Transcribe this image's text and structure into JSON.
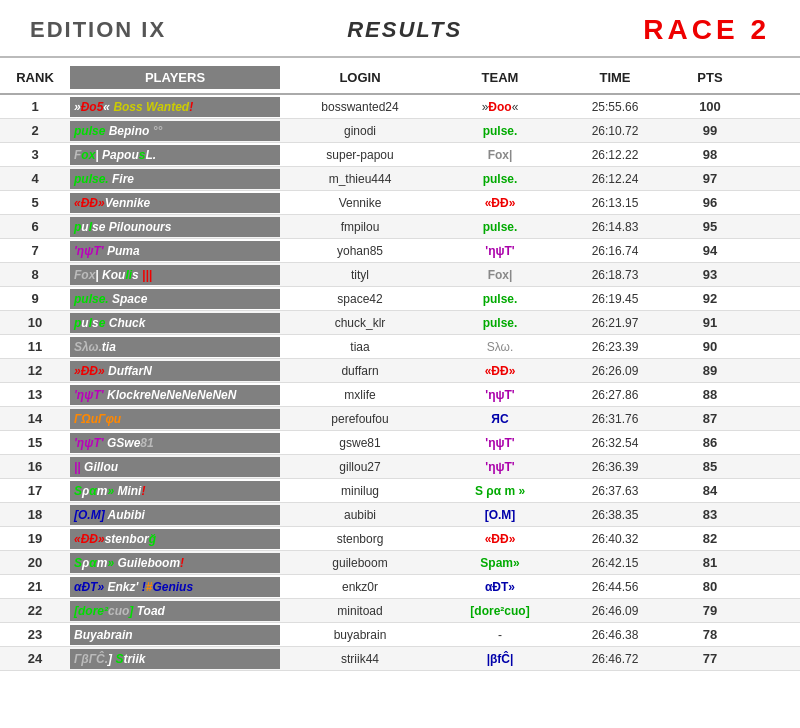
{
  "header": {
    "edition": "EDITION IX",
    "results": "RESULTS",
    "race": "RACE  2"
  },
  "columns": {
    "rank": "RANK",
    "players": "PLAYERS",
    "login": "LOGIN",
    "team": "TEAM",
    "time": "TIME",
    "pts": "PTS"
  },
  "rows": [
    {
      "rank": "1",
      "player_html": "»<span class='p-red'>Ðo5</span>« <span class='p-yellow'>Boss Wanted</span><span class='p-red'>!</span>",
      "login": "bosswanted24",
      "team_html": "»<span class='team-dd'>Ðoo</span>«",
      "time": "25:55.66",
      "pts": "100"
    },
    {
      "rank": "2",
      "player_html": "<span class='p-green'>pulse</span> <span class='p-white'>Bepino</span> <span class='p-gray'>°°</span>",
      "login": "ginodi",
      "team_html": "<span class='team-pulse'>pulse.</span>",
      "time": "26:10.72",
      "pts": "99"
    },
    {
      "rank": "3",
      "player_html": "<span class='p-gray'>F</span><span class='p-green'>ox</span><span class='p-white'>|</span> <span class='p-white'>Papou</span><span class='p-green'>s</span><span class='p-white'>L.</span>",
      "login": "super-papou",
      "team_html": "<span class='team-fox'>Fox|</span>",
      "time": "26:12.22",
      "pts": "98"
    },
    {
      "rank": "4",
      "player_html": "<span class='p-green'>pulse.</span> <span class='p-white'>Fire</span>",
      "login": "m_thieu444",
      "team_html": "<span class='team-pulse'>pulse.</span>",
      "time": "26:12.24",
      "pts": "97"
    },
    {
      "rank": "5",
      "player_html": "<span class='p-red'>«ÐÐ»</span><span class='p-white'>Vennike</span>",
      "login": "Vennike",
      "team_html": "<span class='team-dd'>«ÐÐ»</span>",
      "time": "26:13.15",
      "pts": "96"
    },
    {
      "rank": "6",
      "player_html": "<span class='p-green'>p</span><span class='p-white'>u</span><span class='p-green'>l</span><span class='p-white'>se</span> <span class='p-white'>Pilounours</span>",
      "login": "fmpilou",
      "team_html": "<span class='team-pulse'>pulse.</span>",
      "time": "26:14.83",
      "pts": "95"
    },
    {
      "rank": "7",
      "player_html": "<span class='p-purple'>'ηψΤ'</span> <span class='p-white'>Puma</span>",
      "login": "yohan85",
      "team_html": "<span class='team-hut'>'ηψΤ'</span>",
      "time": "26:16.74",
      "pts": "94"
    },
    {
      "rank": "8",
      "player_html": "<span class='p-gray'>Fox</span><span class='p-white'>| </span><span class='p-white'>Kou</span><span class='p-green'>li</span><span class='p-white'>s</span> <span class='p-red'>|||</span>",
      "login": "tityl",
      "team_html": "<span class='team-fox'>Fox|</span>",
      "time": "26:18.73",
      "pts": "93"
    },
    {
      "rank": "9",
      "player_html": "<span class='p-green'>pulse.</span> <span class='p-white'>Space</span>",
      "login": "space42",
      "team_html": "<span class='team-pulse'>pulse.</span>",
      "time": "26:19.45",
      "pts": "92"
    },
    {
      "rank": "10",
      "player_html": "<span class='p-green'>p</span><span class='p-white'>u</span><span class='p-green'>l</span><span class='p-white'>s</span><span class='p-green'>e</span> <span class='p-white'>Chuck</span>",
      "login": "chuck_klr",
      "team_html": "<span class='team-pulse'>pulse.</span>",
      "time": "26:21.97",
      "pts": "91"
    },
    {
      "rank": "11",
      "player_html": "<span class='p-gray'>Sλω.</span><span class='p-white'>tia</span>",
      "login": "tiaa",
      "team_html": "<span class='team-slaw'>Sλω.</span>",
      "time": "26:23.39",
      "pts": "90"
    },
    {
      "rank": "12",
      "player_html": "<span class='p-red'>»ÐÐ»</span> <span class='p-white'>DuffarN</span>",
      "login": "duffarn",
      "team_html": "<span class='team-dd'>«ÐÐ»</span>",
      "time": "26:26.09",
      "pts": "89"
    },
    {
      "rank": "13",
      "player_html": "<span class='p-purple'>'ηψΤ'</span> <span class='p-white'>KlockreNeNeNeNeNeN</span>",
      "login": "mxlife",
      "team_html": "<span class='team-hut'>'ηψΤ'</span>",
      "time": "26:27.86",
      "pts": "88"
    },
    {
      "rank": "14",
      "player_html": "<span class='p-orange'>ГΩuΓφu</span>",
      "login": "perefoufou",
      "team_html": "<span class='team-rc'>ЯC</span>",
      "time": "26:31.76",
      "pts": "87"
    },
    {
      "rank": "15",
      "player_html": "<span class='p-purple'>'ηψΤ'</span> <span class='p-white'>GSwe</span><span class='p-gray'>81</span>",
      "login": "gswe81",
      "team_html": "<span class='team-hut'>'ηψΤ'</span>",
      "time": "26:32.54",
      "pts": "86"
    },
    {
      "rank": "16",
      "player_html": "<span class='p-purple'>||</span> <span class='p-white'>Gillou</span>",
      "login": "gillou27",
      "team_html": "<span class='team-hut'>'ηψΤ'</span>",
      "time": "26:36.39",
      "pts": "85"
    },
    {
      "rank": "17",
      "player_html": "<span class='p-green'>S</span><span class='p-white'>ρ</span><span class='p-green'>α</span><span class='p-white'>m</span><span class='p-green'>»</span> <span class='p-white'>Mini</span><span class='p-red'>!</span>",
      "login": "minilug",
      "team_html": "<span class='team-spam'>S ρα m »</span>",
      "time": "26:37.63",
      "pts": "84"
    },
    {
      "rank": "18",
      "player_html": "<span class='p-blue'>[O.M]</span> <span class='p-white'>Aubibi</span>",
      "login": "aubibi",
      "team_html": "<span class='team-om'>[O.M]</span>",
      "time": "26:38.35",
      "pts": "83"
    },
    {
      "rank": "19",
      "player_html": "<span class='p-red'>«ÐÐ»</span><span class='p-white'>stenbor</span><span class='p-green'>ğ</span>",
      "login": "stenborg",
      "team_html": "<span class='team-dd'>«ÐÐ»</span>",
      "time": "26:40.32",
      "pts": "82"
    },
    {
      "rank": "20",
      "player_html": "<span class='p-green'>S</span><span class='p-white'>ρ</span><span class='p-green'>α</span><span class='p-white'>m</span><span class='p-green'>»</span> <span class='p-white'>Guileboom</span><span class='p-red'>!</span>",
      "login": "guileboom",
      "team_html": "<span class='team-spam'>Spam»</span>",
      "time": "26:42.15",
      "pts": "81"
    },
    {
      "rank": "21",
      "player_html": "<span class='p-blue'>αÐΤ»</span> <span class='p-white'>Enkz'</span> <span class='p-blue'>!</span><span class='p-orange'>#</span><span class='p-blue'>Genius</span>",
      "login": "enkz0r",
      "team_html": "<span class='team-adt'>αÐΤ»</span>",
      "time": "26:44.56",
      "pts": "80"
    },
    {
      "rank": "22",
      "player_html": "<span class='p-green'>[dore²</span><span class='p-gray'>cuo</span><span class='p-green'>]</span> <span class='p-white'>Toad</span>",
      "login": "minitoad",
      "team_html": "<span class='team-dore'>[dore²cuo]</span>",
      "time": "26:46.09",
      "pts": "79"
    },
    {
      "rank": "23",
      "player_html": "<span class='p-white'>Buyabrain</span>",
      "login": "buyabrain",
      "team_html": "<span class='team-none'>-</span>",
      "time": "26:46.38",
      "pts": "78"
    },
    {
      "rank": "24",
      "player_html": "<span class='p-gray'>ΓβΓĈ.</span><span class='p-white'>]</span> <span class='p-green'>S</span><span class='p-white'>triik</span>",
      "login": "striik44",
      "team_html": "<span class='team-bfc'>|βfĈ|</span>",
      "time": "26:46.72",
      "pts": "77"
    }
  ]
}
